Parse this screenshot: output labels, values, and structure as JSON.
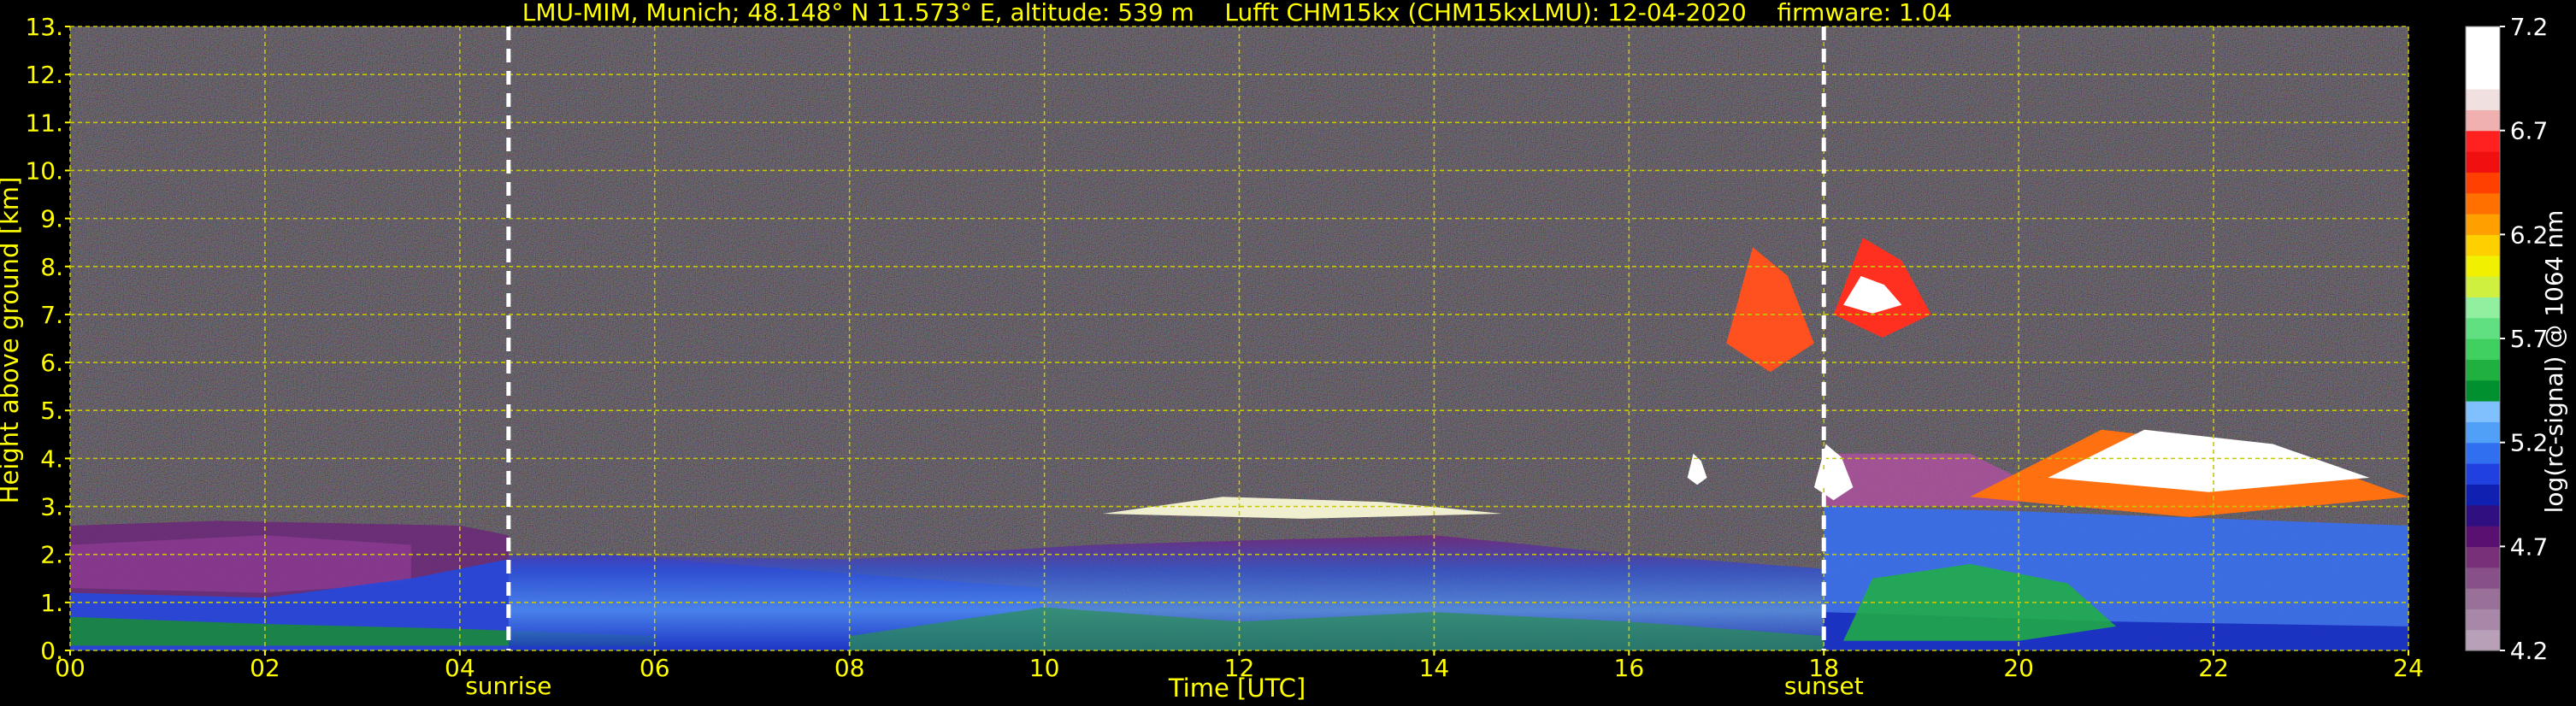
{
  "chart_data": {
    "type": "heatmap",
    "title": "LMU-MIM, Munich; 48.148° N 11.573° E, altitude: 539 m    Lufft CHM15kx (CHM15kxLMU): 12-04-2020    firmware: 1.04",
    "xlabel": "Time [UTC]",
    "ylabel": "Height above ground [km]",
    "xlim": [
      0,
      24
    ],
    "ylim": [
      0,
      13
    ],
    "x_ticks": [
      "00",
      "02",
      "04",
      "06",
      "08",
      "10",
      "12",
      "14",
      "16",
      "18",
      "20",
      "22",
      "24"
    ],
    "y_ticks": [
      "0.",
      "1.",
      "2.",
      "3.",
      "4.",
      "5.",
      "6.",
      "7.",
      "8.",
      "9.",
      "10.",
      "11.",
      "12.",
      "13."
    ],
    "grid": true,
    "events": [
      {
        "label": "sunrise",
        "time": 4.5
      },
      {
        "label": "sunset",
        "time": 18.0
      }
    ],
    "colorbar": {
      "label": "log(rc-signal) @ 1064 nm",
      "min": 4.2,
      "max": 7.2,
      "ticks": [
        "4.2",
        "4.7",
        "5.2",
        "5.7",
        "6.2",
        "6.7",
        "7.2"
      ],
      "colors": [
        "#b8a0b8",
        "#a888a8",
        "#987098",
        "#885088",
        "#783078",
        "#5a1070",
        "#301080",
        "#1020b0",
        "#2040e0",
        "#3070f0",
        "#50a0f8",
        "#80c0ff",
        "#009030",
        "#20b040",
        "#40d060",
        "#60e080",
        "#90f0a0",
        "#d0f040",
        "#f0f000",
        "#ffd000",
        "#ffa000",
        "#ff7000",
        "#ff4000",
        "#f01010",
        "#ff2020",
        "#f0b0b0",
        "#f0e0e0",
        "#ffffff",
        "#ffffff",
        "#ffffff"
      ]
    },
    "colors": {
      "background": "#000000",
      "text": "#ffff00",
      "grid": "#c8c800",
      "event_line": "#ffffff",
      "colorbar_text": "#ffffff"
    }
  }
}
